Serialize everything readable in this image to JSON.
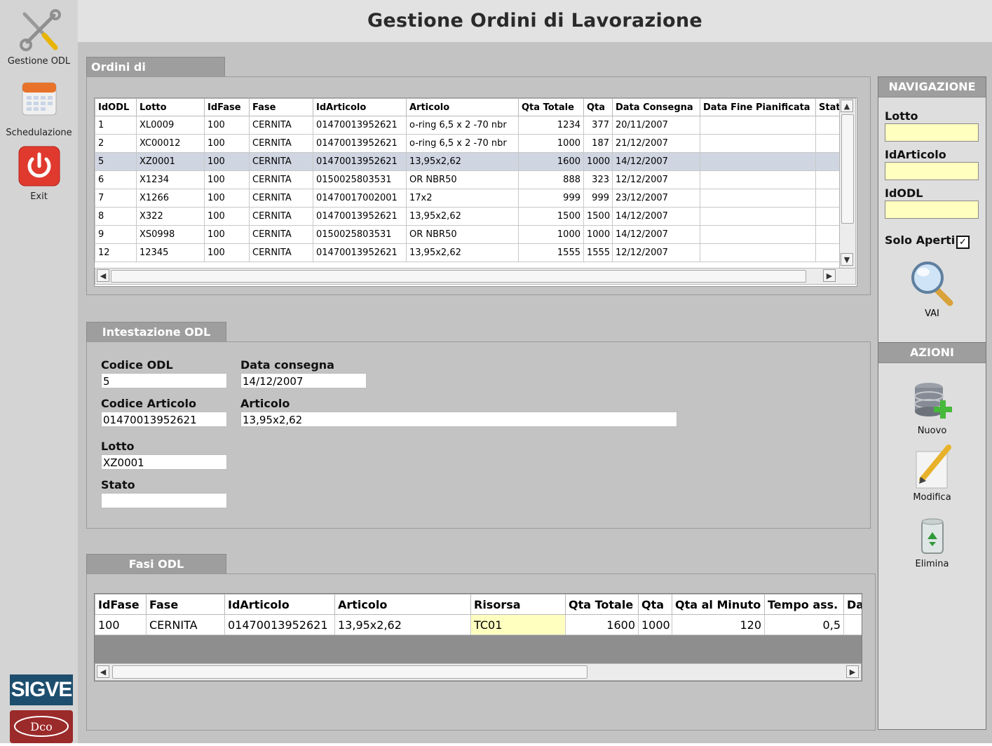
{
  "app": {
    "title": "Gestione Ordini di Lavorazione"
  },
  "sidebar": {
    "items": [
      {
        "label": "Gestione ODL",
        "icon": "tools-icon"
      },
      {
        "label": "Schedulazione",
        "icon": "calendar-icon"
      },
      {
        "label": "Exit",
        "icon": "power-icon"
      }
    ],
    "logos": {
      "sigve": "SIGVE",
      "bottom": "Dco"
    }
  },
  "orders": {
    "tab_label": "Ordini di Lavorazione",
    "columns": [
      "IdODL",
      "Lotto",
      "IdFase",
      "Fase",
      "IdArticolo",
      "Articolo",
      "Qta Totale",
      "Qta",
      "Data Consegna",
      "Data Fine Pianificata",
      "Stat"
    ],
    "rows": [
      [
        "1",
        "XL0009",
        "100",
        "CERNITA",
        "01470013952621",
        "o-ring 6,5 x 2  -70 nbr",
        "1234",
        "377",
        "20/11/2007",
        "",
        ""
      ],
      [
        "2",
        "XC00012",
        "100",
        "CERNITA",
        "01470013952621",
        "o-ring 6,5 x 2  -70 nbr",
        "1000",
        "187",
        "21/12/2007",
        "",
        ""
      ],
      [
        "5",
        "XZ0001",
        "100",
        "CERNITA",
        "01470013952621",
        "13,95x2,62",
        "1600",
        "1000",
        "14/12/2007",
        "",
        ""
      ],
      [
        "6",
        "X1234",
        "100",
        "CERNITA",
        "0150025803531",
        "OR NBR50",
        "888",
        "323",
        "12/12/2007",
        "",
        ""
      ],
      [
        "7",
        "X1266",
        "100",
        "CERNITA",
        "01470017002001",
        "17x2",
        "999",
        "999",
        "23/12/2007",
        "",
        ""
      ],
      [
        "8",
        "X322",
        "100",
        "CERNITA",
        "01470013952621",
        "13,95x2,62",
        "1500",
        "1500",
        "14/12/2007",
        "",
        ""
      ],
      [
        "9",
        "XS0998",
        "100",
        "CERNITA",
        "0150025803531",
        "OR NBR50",
        "1000",
        "1000",
        "14/12/2007",
        "",
        ""
      ],
      [
        "12",
        "12345",
        "100",
        "CERNITA",
        "01470013952621",
        "13,95x2,62",
        "1555",
        "1555",
        "12/12/2007",
        "",
        ""
      ]
    ],
    "selected_row": 2
  },
  "header_odl": {
    "tab_label": "Intestazione ODL",
    "fields": {
      "codice_odl": {
        "label": "Codice ODL",
        "value": "5"
      },
      "data_consegna": {
        "label": "Data consegna",
        "value": "14/12/2007"
      },
      "codice_articolo": {
        "label": "Codice Articolo",
        "value": "01470013952621"
      },
      "articolo": {
        "label": "Articolo",
        "value": "13,95x2,62"
      },
      "lotto": {
        "label": "Lotto",
        "value": "XZ0001"
      },
      "stato": {
        "label": "Stato",
        "value": ""
      }
    }
  },
  "fasi": {
    "tab_label": "Fasi ODL",
    "columns": [
      "IdFase",
      "Fase",
      "IdArticolo",
      "Articolo",
      "Risorsa",
      "Qta Totale",
      "Qta",
      "Qta al Minuto",
      "Tempo ass.",
      "Da"
    ],
    "rows": [
      [
        "100",
        "CERNITA",
        "01470013952621",
        "13,95x2,62",
        "TC01",
        "1600",
        "1000",
        "120",
        "0,5",
        ""
      ]
    ]
  },
  "navigazione": {
    "title": "NAVIGAZIONE",
    "lotto_label": "Lotto",
    "idarticolo_label": "IdArticolo",
    "idodl_label": "IdODL",
    "solo_aperti_label": "Solo Aperti",
    "solo_aperti_checked": true,
    "go_label": "VAI"
  },
  "azioni": {
    "title": "AZIONI",
    "nuovo": "Nuovo",
    "modifica": "Modifica",
    "elimina": "Elimina"
  },
  "colors": {
    "accent_tab": "#9e9e9e",
    "highlight_input": "#ffffc0",
    "selected_row": "#cfd6e2",
    "exit_red": "#e03a2f"
  }
}
